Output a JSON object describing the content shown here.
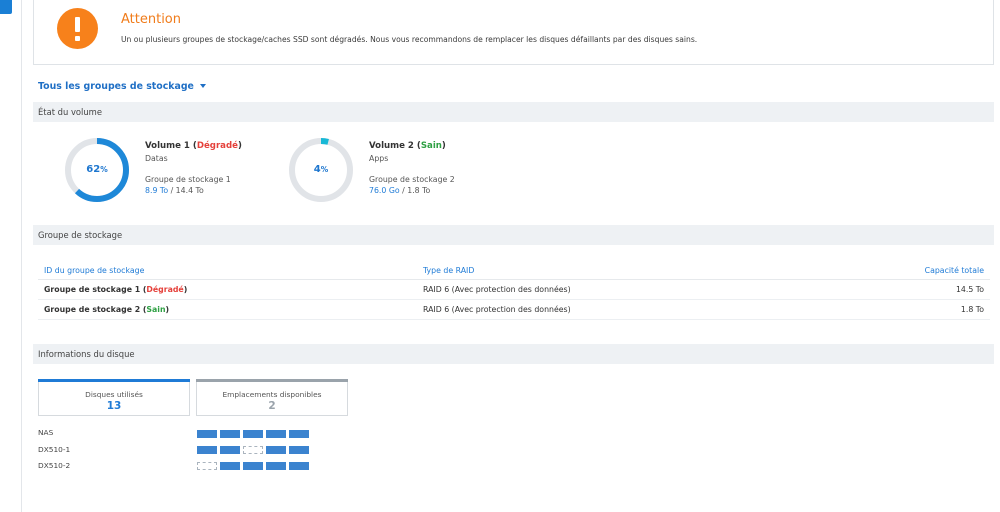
{
  "alert": {
    "title": "Attention",
    "message": "Un ou plusieurs groupes de stockage/caches SSD sont dégradés. Nous vous recommandons de remplacer les disques défaillants par des disques sains.",
    "color": "#f7811b"
  },
  "filter": {
    "label": "Tous les groupes de stockage"
  },
  "sections": {
    "volume_state": "État du volume",
    "storage_pool": "Groupe de stockage",
    "disk_info": "Informations du disque"
  },
  "volumes": [
    {
      "percent": 62,
      "pct_text": "62",
      "pct_sign": "%",
      "name": "Volume 1",
      "status": "Dégradé",
      "desc": "Datas",
      "group": "Groupe de stockage 1",
      "used": "8.9 To",
      "total": "/ 14.4 To"
    },
    {
      "percent": 4,
      "pct_text": "4",
      "pct_sign": "%",
      "name": "Volume 2",
      "status": "Sain",
      "desc": "Apps",
      "group": "Groupe de stockage 2",
      "used": "76.0 Go",
      "total": "/ 1.8 To"
    }
  ],
  "pool_table": {
    "headers": [
      "ID du groupe de stockage",
      "Type de RAID",
      "Capacité totale"
    ],
    "rows": [
      {
        "name": "Groupe de stockage 1",
        "status": "Dégradé",
        "raid": "RAID 6 (Avec protection des données)",
        "capacity": "14.5 To"
      },
      {
        "name": "Groupe de stockage 2",
        "status": "Sain",
        "raid": "RAID 6 (Avec protection des données)",
        "capacity": "1.8 To"
      }
    ]
  },
  "disk_cards": [
    {
      "label": "Disques utilisés",
      "value": "13",
      "accent": "#1f7bd6"
    },
    {
      "label": "Emplacements disponibles",
      "value": "2",
      "accent": "#9aa3ab"
    }
  ],
  "enclosures": [
    {
      "name": "NAS",
      "slots": [
        1,
        1,
        1,
        1,
        1
      ]
    },
    {
      "name": "DX510-1",
      "slots": [
        1,
        1,
        0,
        1,
        1
      ]
    },
    {
      "name": "DX510-2",
      "slots": [
        0,
        1,
        1,
        1,
        1
      ]
    }
  ],
  "colors": {
    "accent": "#1f7bd6",
    "degraded": "#e5413b",
    "healthy": "#2ea043",
    "donut_blue": "#1e88d8",
    "donut_cyan": "#17b8d6",
    "donut_track": "#e1e4e8"
  }
}
